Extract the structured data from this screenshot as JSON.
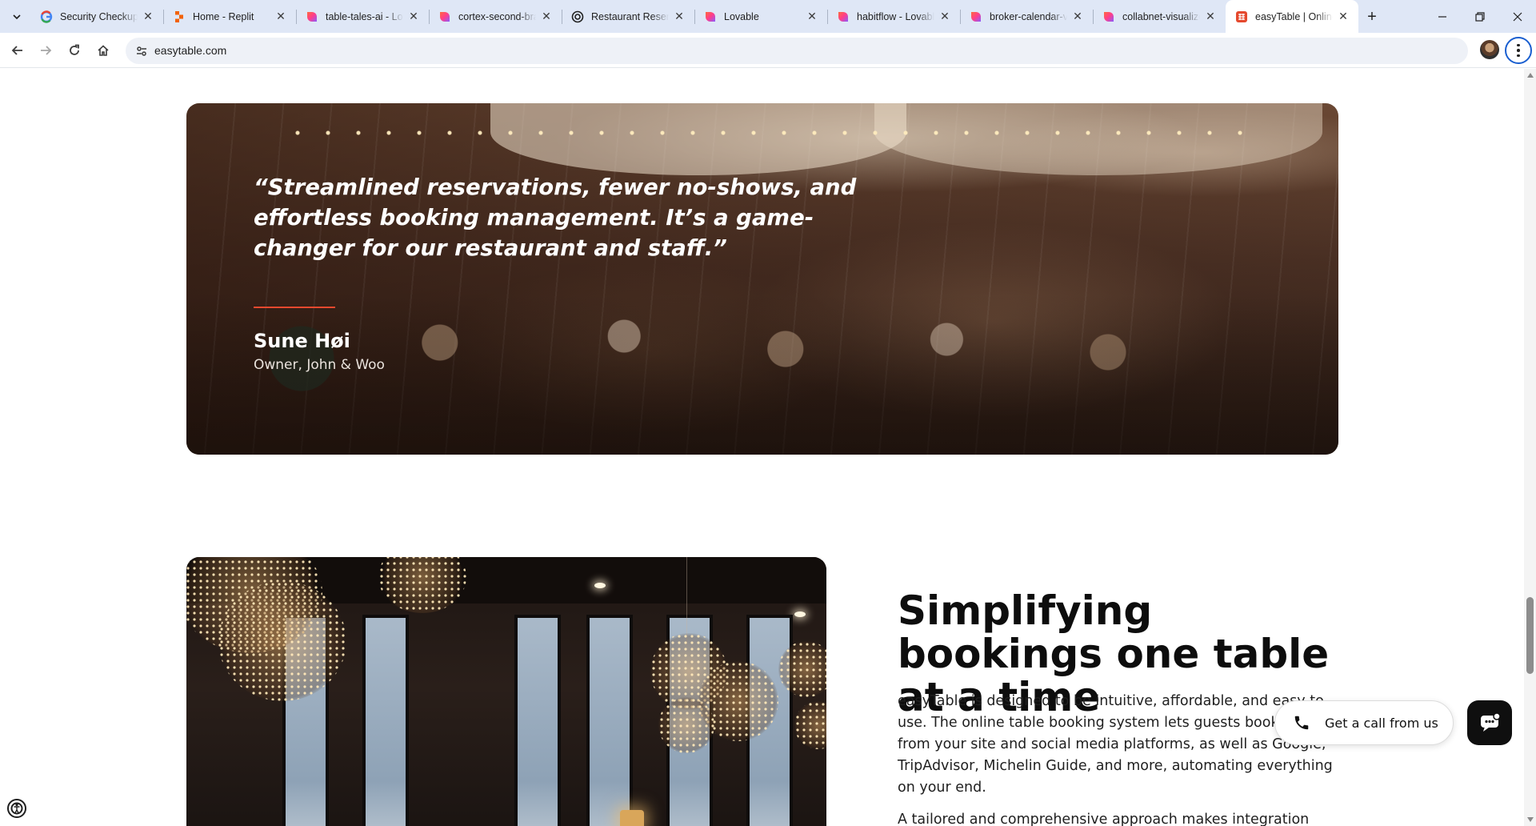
{
  "browser": {
    "tabs": [
      {
        "title": "Security Checkup",
        "icon": "google-icon"
      },
      {
        "title": "Home - Replit",
        "icon": "replit-icon"
      },
      {
        "title": "table-tales-ai - Lovable",
        "icon": "lovable-icon"
      },
      {
        "title": "cortex-second-brain - Lovable",
        "icon": "lovable-icon"
      },
      {
        "title": "Restaurant Reservations",
        "icon": "openai-icon"
      },
      {
        "title": "Lovable",
        "icon": "lovable-icon"
      },
      {
        "title": "habitflow - Lovable",
        "icon": "lovable-icon"
      },
      {
        "title": "broker-calendar-view - Lovable",
        "icon": "lovable-icon"
      },
      {
        "title": "collabnet-visualizer - Lovable",
        "icon": "lovable-icon"
      },
      {
        "title": "easyTable | Online table booking",
        "icon": "easytable-icon",
        "active": true
      }
    ],
    "url": "easytable.com"
  },
  "testimonial": {
    "quote": "“Streamlined reservations, fewer no-shows, and effortless booking management. It’s a game-changer for our restaurant and staff.”",
    "author": "Sune Høi",
    "role": "Owner, John & Woo",
    "accent_color": "#e5492e"
  },
  "feature": {
    "headline": "Simplifying bookings one table at a time",
    "paragraph_1": "easyTable is designed to be intuitive, affordable, and easy to use. The online table booking system lets guests book directly from your site and social media platforms, as well as Google, TripAdvisor, Michelin Guide, and more, automating everything on your end.",
    "paragraph_2": "A tailored and comprehensive approach makes integration"
  },
  "widgets": {
    "callback_label": "Get a call from us",
    "chat_icon": "chat-bubble-icon"
  },
  "colors": {
    "tabstrip_bg": "#dfe7f6",
    "text_dark": "#0d0d0d",
    "accent": "#e5492e"
  }
}
